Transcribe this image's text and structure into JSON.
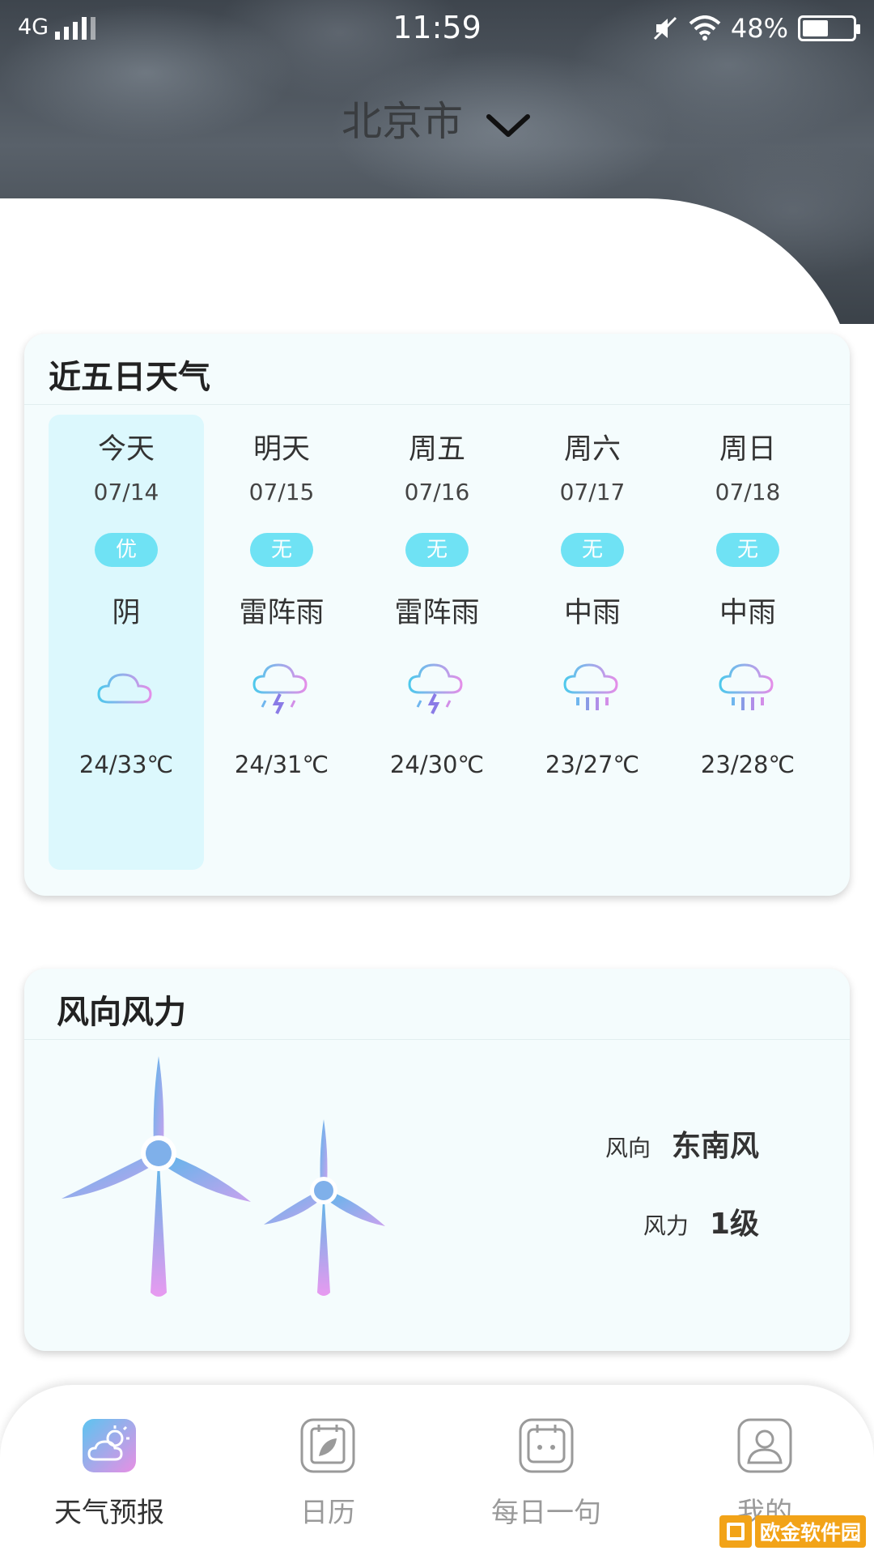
{
  "status_bar": {
    "network": "4G",
    "time": "11:59",
    "battery": "48%"
  },
  "header": {
    "city": "北京市"
  },
  "forecast": {
    "title": "近五日天气",
    "days": [
      {
        "name": "今天",
        "date": "07/14",
        "aqi": "优",
        "condition": "阴",
        "temp": "24/33℃",
        "icon": "cloudy-icon"
      },
      {
        "name": "明天",
        "date": "07/15",
        "aqi": "无",
        "condition": "雷阵雨",
        "temp": "24/31℃",
        "icon": "thunderstorm-icon"
      },
      {
        "name": "周五",
        "date": "07/16",
        "aqi": "无",
        "condition": "雷阵雨",
        "temp": "24/30℃",
        "icon": "thunderstorm-icon"
      },
      {
        "name": "周六",
        "date": "07/17",
        "aqi": "无",
        "condition": "中雨",
        "temp": "23/27℃",
        "icon": "rain-icon"
      },
      {
        "name": "周日",
        "date": "07/18",
        "aqi": "无",
        "condition": "中雨",
        "temp": "23/28℃",
        "icon": "rain-icon"
      }
    ]
  },
  "wind": {
    "title": "风向风力",
    "direction_label": "风向",
    "direction_value": "东南风",
    "force_label": "风力",
    "force_value": "1级"
  },
  "tabbar": {
    "tabs": [
      {
        "label": "天气预报",
        "icon": "weather-forecast-icon",
        "active": true
      },
      {
        "label": "日历",
        "icon": "calendar-leaf-icon",
        "active": false
      },
      {
        "label": "每日一句",
        "icon": "calendar-icon",
        "active": false
      },
      {
        "label": "我的",
        "icon": "user-icon",
        "active": false
      }
    ]
  },
  "watermark": {
    "text": "欧金软件园"
  },
  "colors": {
    "aqi_badge": "#6fe2f4",
    "today_highlight": "#dcf8fd",
    "card_background": "#f4fcfd"
  }
}
